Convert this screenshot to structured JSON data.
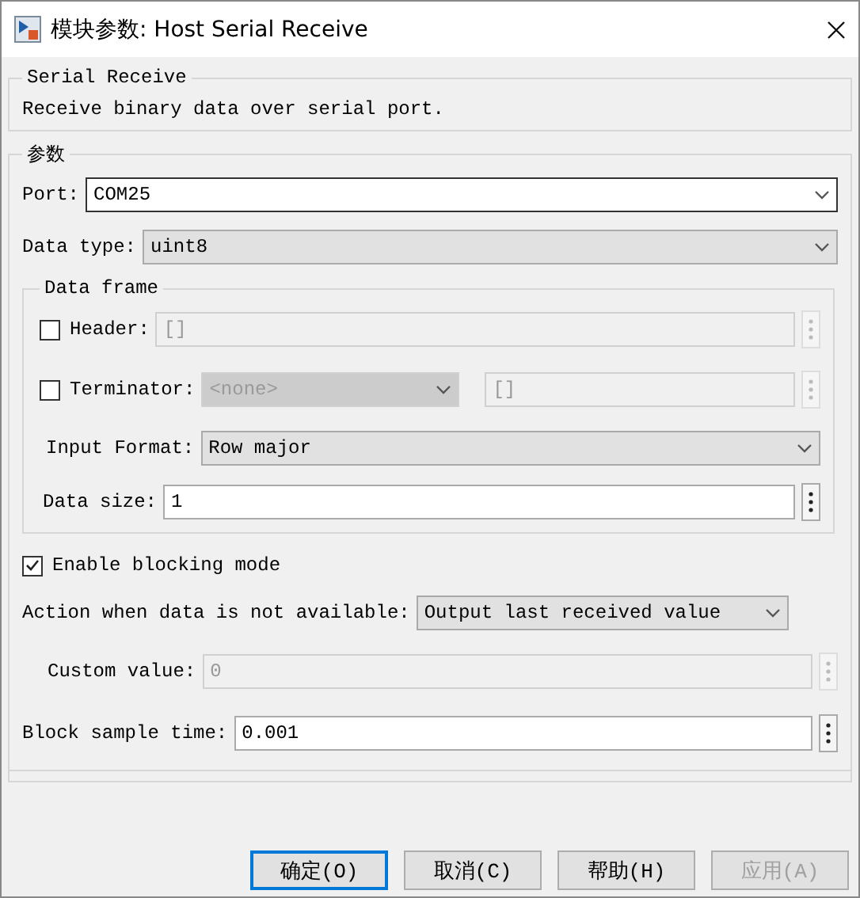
{
  "window": {
    "title": "模块参数: Host Serial Receive"
  },
  "description_group": {
    "title": "Serial Receive",
    "text": "Receive binary data over serial port."
  },
  "parameters": {
    "title": "参数",
    "port": {
      "label": "Port:",
      "value": "COM25",
      "kind": "combo",
      "disabled": false
    },
    "data_type": {
      "label": "Data type:",
      "value": "uint8",
      "kind": "select",
      "disabled": false
    },
    "data_frame": {
      "title": "Data frame",
      "header": {
        "label": "Header:",
        "checked": false,
        "value": "[]",
        "disabled": true
      },
      "terminator": {
        "label": "Terminator:",
        "checked": false,
        "select_value": "<none>",
        "value": "[]",
        "disabled": true
      },
      "input_format": {
        "label": "Input Format:",
        "value": "Row major",
        "kind": "select",
        "disabled": false
      },
      "data_size": {
        "label": "Data size:",
        "value": "1",
        "disabled": false
      }
    },
    "enable_blocking": {
      "label": "Enable blocking mode",
      "checked": true
    },
    "action": {
      "label": "Action when data is not available:",
      "value": "Output last received value",
      "kind": "select",
      "disabled": false
    },
    "custom_value": {
      "label": "Custom value:",
      "value": "0",
      "disabled": true
    },
    "block_sample_time": {
      "label": "Block sample time:",
      "value": "0.001",
      "disabled": false
    }
  },
  "buttons": [
    {
      "label": "确定(O)",
      "focused": true,
      "disabled": false
    },
    {
      "label": "取消(C)",
      "focused": false,
      "disabled": false
    },
    {
      "label": "帮助(H)",
      "focused": false,
      "disabled": false
    },
    {
      "label": "应用(A)",
      "focused": false,
      "disabled": true
    }
  ]
}
